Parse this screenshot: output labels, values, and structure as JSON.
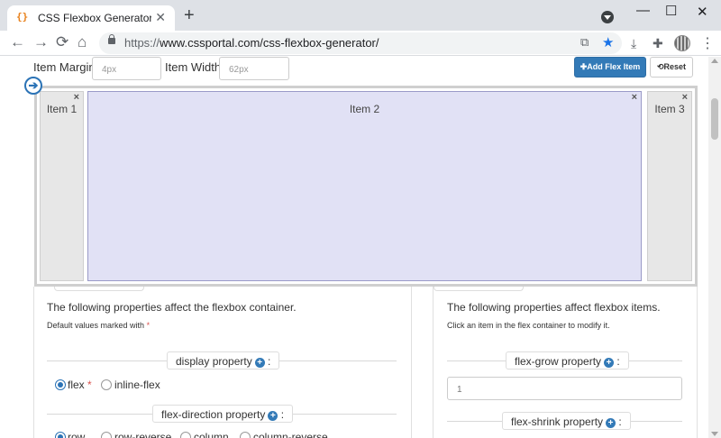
{
  "browser": {
    "tab_title": "CSS Flexbox Generator - CSS Portal",
    "tab_favicon": "{}",
    "url_scheme": "https://",
    "url_rest": "www.cssportal.com/css-flexbox-generator/"
  },
  "icons": {
    "new_tab": "+",
    "tab_close": "✕",
    "back": "←",
    "forward": "→",
    "reload": "⟳",
    "home": "⌂",
    "translate": "⧉",
    "star": "★",
    "download": "⤓",
    "extensions": "✚",
    "menu": "⋮",
    "minimize": "—",
    "maximize": "☐",
    "close": "✕",
    "item_close": "×",
    "toggle": "➔",
    "plus": "+"
  },
  "controls": {
    "item_margin_label": "Item Margin",
    "item_margin_placeholder": "4px",
    "item_width_label": "Item Width",
    "item_width_placeholder": "62px",
    "add_button": "✚Add Flex Item",
    "reset_button": "⟲Reset"
  },
  "flex_items": [
    {
      "label": "Item 1"
    },
    {
      "label": "Item 2"
    },
    {
      "label": "Item 3"
    }
  ],
  "container_panel": {
    "lead": "The following properties affect the flexbox container.",
    "sub": "Default values marked with",
    "asterisk": "*",
    "display_title": "display property",
    "display_options": [
      "flex",
      "inline-flex"
    ],
    "display_selected": "flex",
    "flex_direction_title": "flex-direction property",
    "flex_direction_options": [
      "row",
      "row-reverse",
      "column",
      "column-reverse"
    ]
  },
  "items_panel": {
    "lead": "The following properties affect flexbox items.",
    "sub": "Click an item in the flex container to modify it.",
    "flex_grow_title": "flex-grow property",
    "flex_grow_value": "1",
    "flex_shrink_title": "flex-shrink property"
  },
  "colors": {
    "primary": "#337ab7",
    "selected_item": "#e1e1f5",
    "item": "#e7e7e7"
  }
}
